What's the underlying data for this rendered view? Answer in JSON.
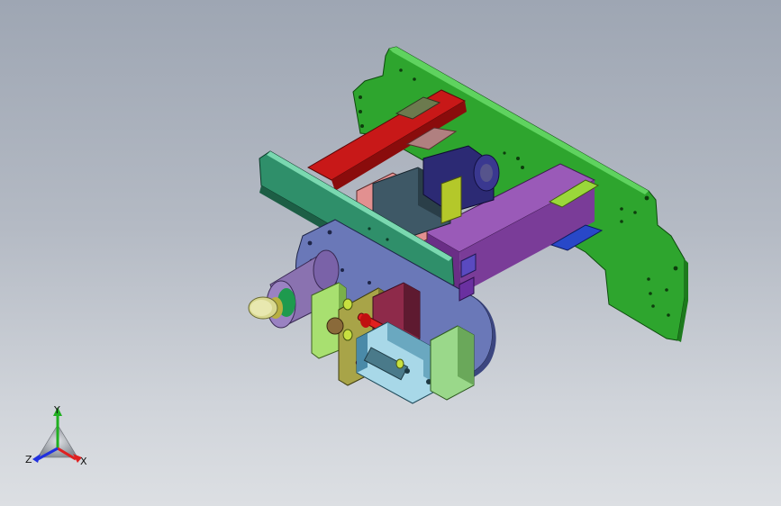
{
  "viewport": {
    "background_top": "#9ea6b3",
    "background_bottom": "#dcdfe3"
  },
  "triad": {
    "x_label": "X",
    "y_label": "Y",
    "z_label": "Z",
    "x_color": "#e02020",
    "y_color": "#20b020",
    "z_color": "#2030e0"
  }
}
